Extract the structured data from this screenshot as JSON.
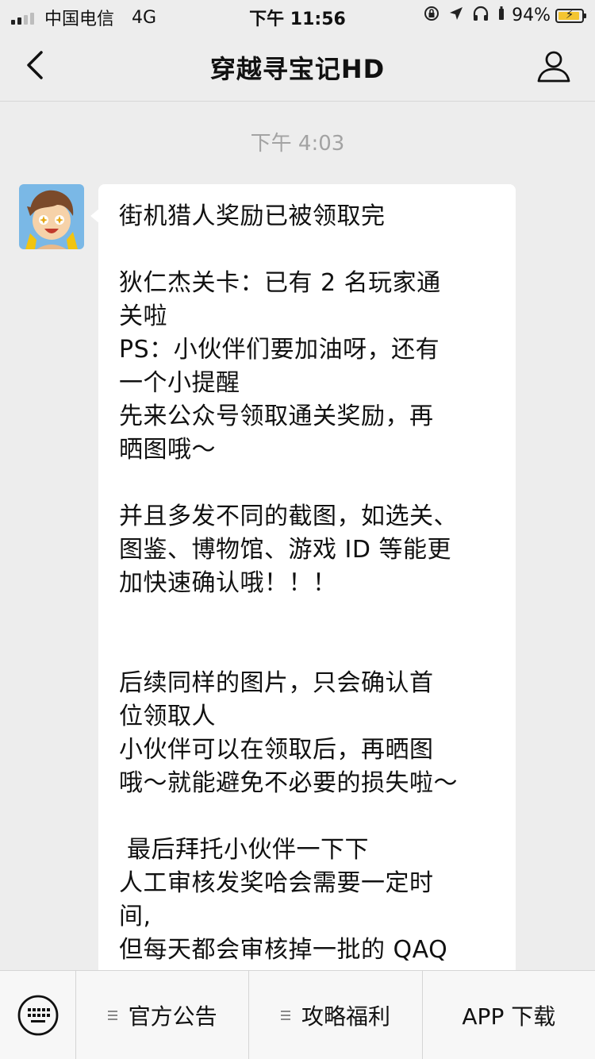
{
  "status_bar": {
    "carrier": "中国电信",
    "network": "4G",
    "time": "下午 11:56",
    "battery_percent": "94%",
    "battery_level": 0.94,
    "signal_bars": 4,
    "signal_active_bars": 2,
    "battery_color": "#f4c531",
    "icons": [
      "rotation-lock-icon",
      "location-arrow-icon",
      "headphones-icon",
      "alarm-icon"
    ]
  },
  "nav": {
    "title": "穿越寻宝记HD",
    "back_icon": "chevron-left-icon",
    "profile_icon": "person-icon"
  },
  "chat": {
    "timestamp": "下午 4:03",
    "message": {
      "sender_avatar": "game-character-avatar",
      "lines": [
        "街机猎人奖励已被领取完",
        "",
        "狄仁杰关卡：已有 2 名玩家通",
        "关啦",
        "PS：小伙伴们要加油呀，还有",
        "一个小提醒",
        "先来公众号领取通关奖励，再",
        "晒图哦～",
        "",
        "并且多发不同的截图，如选关、",
        "图鉴、博物馆、游戏 ID 等能更",
        "加快速确认哦！！！",
        "",
        "",
        "后续同样的图片，只会确认首",
        "位领取人",
        "小伙伴可以在领取后，再晒图",
        "哦～就能避免不必要的损失啦～",
        "",
        " 最后拜托小伙伴一下下",
        "人工审核发奖哈会需要一定时",
        "间,",
        "但每天都会审核掉一批的 QAQ"
      ]
    }
  },
  "bottom_menu": {
    "keyboard_icon": "keyboard-icon",
    "items": [
      {
        "label": "官方公告",
        "has_submenu": true
      },
      {
        "label": "攻略福利",
        "has_submenu": true
      },
      {
        "label": "APP 下载",
        "has_submenu": false
      }
    ]
  }
}
